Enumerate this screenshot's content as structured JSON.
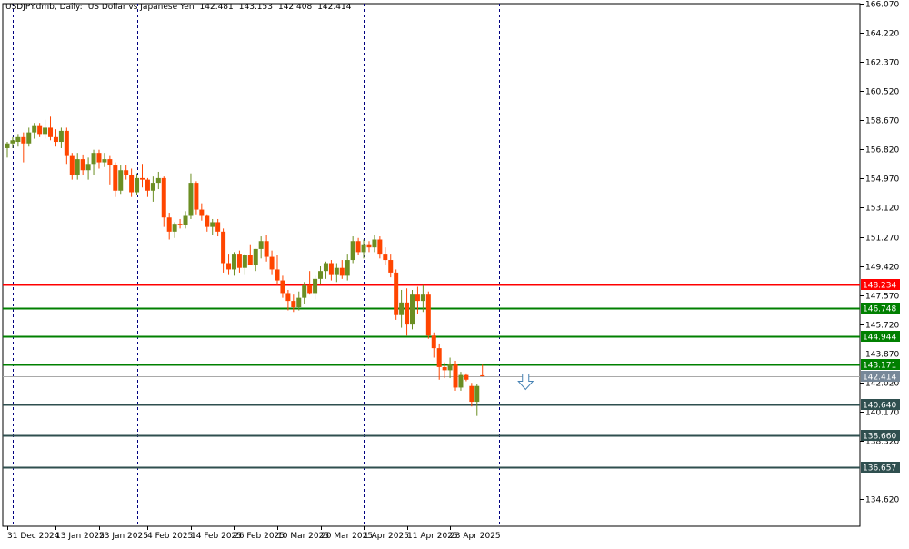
{
  "header": {
    "symbol": "USDJPY.dmb, Daily:",
    "description": "US Dollar vs Japanese Yen",
    "open": "142.481",
    "high": "143.153",
    "low": "142.408",
    "close": "142.414"
  },
  "chart_data": {
    "type": "candlestick",
    "ylim": [
      132.9,
      166.07
    ],
    "y_ticks": [
      "166.070",
      "164.220",
      "162.370",
      "160.520",
      "158.670",
      "156.820",
      "154.970",
      "153.120",
      "151.270",
      "149.420",
      "147.570",
      "145.720",
      "143.870",
      "142.020",
      "140.170",
      "138.320",
      "134.620"
    ],
    "x_labels": [
      {
        "label": "31 Dec 2024",
        "index": 0
      },
      {
        "label": "13 Jan 2025",
        "index": 9
      },
      {
        "label": "23 Jan 2025",
        "index": 17
      },
      {
        "label": "4 Feb 2025",
        "index": 26
      },
      {
        "label": "14 Feb 2025",
        "index": 34
      },
      {
        "label": "26 Feb 2025",
        "index": 42
      },
      {
        "label": "10 Mar 2025",
        "index": 50
      },
      {
        "label": "20 Mar 2025",
        "index": 58
      },
      {
        "label": "1 Apr 2025",
        "index": 66
      },
      {
        "label": "11 Apr 2025",
        "index": 74
      },
      {
        "label": "23 Apr 2025",
        "index": 82
      }
    ],
    "period_separators": [
      1,
      24,
      44,
      66,
      91
    ],
    "candles": [
      {
        "o": 156.9,
        "h": 157.3,
        "l": 156.3,
        "c": 157.2
      },
      {
        "o": 157.2,
        "h": 157.6,
        "l": 156.9,
        "c": 157.4
      },
      {
        "o": 157.3,
        "h": 157.8,
        "l": 157.0,
        "c": 157.6
      },
      {
        "o": 157.6,
        "h": 157.9,
        "l": 156.0,
        "c": 157.2
      },
      {
        "o": 157.2,
        "h": 158.2,
        "l": 157.0,
        "c": 157.9
      },
      {
        "o": 157.9,
        "h": 158.5,
        "l": 157.5,
        "c": 158.3
      },
      {
        "o": 158.3,
        "h": 158.5,
        "l": 157.6,
        "c": 157.8
      },
      {
        "o": 157.8,
        "h": 158.7,
        "l": 157.5,
        "c": 158.2
      },
      {
        "o": 158.2,
        "h": 158.9,
        "l": 157.4,
        "c": 157.6
      },
      {
        "o": 157.6,
        "h": 158.1,
        "l": 157.0,
        "c": 157.3
      },
      {
        "o": 157.3,
        "h": 158.2,
        "l": 156.9,
        "c": 158.0
      },
      {
        "o": 158.0,
        "h": 158.2,
        "l": 155.9,
        "c": 156.4
      },
      {
        "o": 156.4,
        "h": 156.6,
        "l": 154.9,
        "c": 155.2
      },
      {
        "o": 155.2,
        "h": 156.6,
        "l": 154.9,
        "c": 156.2
      },
      {
        "o": 156.2,
        "h": 156.5,
        "l": 155.2,
        "c": 155.5
      },
      {
        "o": 155.5,
        "h": 156.3,
        "l": 154.9,
        "c": 155.9
      },
      {
        "o": 155.9,
        "h": 156.8,
        "l": 155.2,
        "c": 156.6
      },
      {
        "o": 156.6,
        "h": 156.8,
        "l": 155.6,
        "c": 156.0
      },
      {
        "o": 156.0,
        "h": 156.6,
        "l": 155.7,
        "c": 156.2
      },
      {
        "o": 156.2,
        "h": 156.4,
        "l": 154.6,
        "c": 155.8
      },
      {
        "o": 155.8,
        "h": 156.0,
        "l": 153.8,
        "c": 154.2
      },
      {
        "o": 154.2,
        "h": 155.8,
        "l": 154.0,
        "c": 155.5
      },
      {
        "o": 155.5,
        "h": 155.8,
        "l": 154.9,
        "c": 155.2
      },
      {
        "o": 155.2,
        "h": 155.6,
        "l": 153.8,
        "c": 154.1
      },
      {
        "o": 154.1,
        "h": 155.3,
        "l": 153.9,
        "c": 155.0
      },
      {
        "o": 155.0,
        "h": 155.9,
        "l": 154.4,
        "c": 154.9
      },
      {
        "o": 154.9,
        "h": 155.0,
        "l": 153.8,
        "c": 154.2
      },
      {
        "o": 154.2,
        "h": 155.1,
        "l": 153.5,
        "c": 154.7
      },
      {
        "o": 154.7,
        "h": 155.4,
        "l": 154.3,
        "c": 155.0
      },
      {
        "o": 155.0,
        "h": 155.1,
        "l": 151.9,
        "c": 152.5
      },
      {
        "o": 152.5,
        "h": 152.8,
        "l": 151.1,
        "c": 151.6
      },
      {
        "o": 151.6,
        "h": 152.2,
        "l": 151.2,
        "c": 152.1
      },
      {
        "o": 152.1,
        "h": 152.4,
        "l": 151.8,
        "c": 152.0
      },
      {
        "o": 152.0,
        "h": 152.9,
        "l": 151.8,
        "c": 152.6
      },
      {
        "o": 152.6,
        "h": 155.3,
        "l": 152.4,
        "c": 154.7
      },
      {
        "o": 154.7,
        "h": 154.8,
        "l": 152.7,
        "c": 153.0
      },
      {
        "o": 153.0,
        "h": 153.4,
        "l": 152.3,
        "c": 152.6
      },
      {
        "o": 152.6,
        "h": 152.7,
        "l": 151.6,
        "c": 151.9
      },
      {
        "o": 151.9,
        "h": 152.4,
        "l": 151.4,
        "c": 152.2
      },
      {
        "o": 152.2,
        "h": 152.4,
        "l": 151.3,
        "c": 151.6
      },
      {
        "o": 151.6,
        "h": 151.8,
        "l": 149.0,
        "c": 149.6
      },
      {
        "o": 149.6,
        "h": 150.2,
        "l": 148.9,
        "c": 149.2
      },
      {
        "o": 149.2,
        "h": 150.3,
        "l": 148.8,
        "c": 150.2
      },
      {
        "o": 150.2,
        "h": 150.4,
        "l": 149.0,
        "c": 149.3
      },
      {
        "o": 149.3,
        "h": 150.2,
        "l": 148.9,
        "c": 150.1
      },
      {
        "o": 150.1,
        "h": 150.8,
        "l": 149.8,
        "c": 149.5
      },
      {
        "o": 149.5,
        "h": 150.5,
        "l": 149.1,
        "c": 150.5
      },
      {
        "o": 150.5,
        "h": 151.3,
        "l": 149.9,
        "c": 151.0
      },
      {
        "o": 151.0,
        "h": 151.4,
        "l": 149.7,
        "c": 150.0
      },
      {
        "o": 150.0,
        "h": 150.4,
        "l": 148.9,
        "c": 149.2
      },
      {
        "o": 149.2,
        "h": 150.1,
        "l": 148.2,
        "c": 148.5
      },
      {
        "o": 148.5,
        "h": 148.8,
        "l": 147.4,
        "c": 147.7
      },
      {
        "o": 147.7,
        "h": 147.9,
        "l": 146.6,
        "c": 147.2
      },
      {
        "o": 147.2,
        "h": 147.6,
        "l": 146.5,
        "c": 146.8
      },
      {
        "o": 146.8,
        "h": 147.8,
        "l": 146.6,
        "c": 147.4
      },
      {
        "o": 147.4,
        "h": 148.4,
        "l": 147.0,
        "c": 148.2
      },
      {
        "o": 148.2,
        "h": 149.1,
        "l": 147.6,
        "c": 147.7
      },
      {
        "o": 147.7,
        "h": 148.8,
        "l": 147.3,
        "c": 148.6
      },
      {
        "o": 148.6,
        "h": 149.4,
        "l": 148.3,
        "c": 149.1
      },
      {
        "o": 149.1,
        "h": 149.7,
        "l": 148.6,
        "c": 149.6
      },
      {
        "o": 149.6,
        "h": 149.8,
        "l": 148.5,
        "c": 148.9
      },
      {
        "o": 148.9,
        "h": 149.6,
        "l": 148.4,
        "c": 149.3
      },
      {
        "o": 149.3,
        "h": 149.8,
        "l": 148.6,
        "c": 148.8
      },
      {
        "o": 148.8,
        "h": 150.2,
        "l": 148.5,
        "c": 149.8
      },
      {
        "o": 149.8,
        "h": 151.3,
        "l": 149.6,
        "c": 151.0
      },
      {
        "o": 151.0,
        "h": 151.2,
        "l": 150.1,
        "c": 150.3
      },
      {
        "o": 150.3,
        "h": 151.1,
        "l": 149.9,
        "c": 150.8
      },
      {
        "o": 150.8,
        "h": 151.0,
        "l": 150.3,
        "c": 150.6
      },
      {
        "o": 150.6,
        "h": 151.4,
        "l": 150.3,
        "c": 151.1
      },
      {
        "o": 151.1,
        "h": 151.3,
        "l": 149.9,
        "c": 150.2
      },
      {
        "o": 150.2,
        "h": 150.6,
        "l": 149.5,
        "c": 149.8
      },
      {
        "o": 149.8,
        "h": 150.2,
        "l": 148.7,
        "c": 149.0
      },
      {
        "o": 149.0,
        "h": 149.2,
        "l": 146.0,
        "c": 146.3
      },
      {
        "o": 146.3,
        "h": 147.9,
        "l": 145.5,
        "c": 147.1
      },
      {
        "o": 147.1,
        "h": 148.0,
        "l": 145.0,
        "c": 145.7
      },
      {
        "o": 145.7,
        "h": 147.9,
        "l": 145.4,
        "c": 147.6
      },
      {
        "o": 147.6,
        "h": 148.1,
        "l": 146.4,
        "c": 147.2
      },
      {
        "o": 147.2,
        "h": 148.2,
        "l": 146.5,
        "c": 147.6
      },
      {
        "o": 147.6,
        "h": 147.8,
        "l": 144.8,
        "c": 145.0
      },
      {
        "o": 145.0,
        "h": 145.2,
        "l": 143.6,
        "c": 144.2
      },
      {
        "o": 144.2,
        "h": 144.5,
        "l": 142.2,
        "c": 143.0
      },
      {
        "o": 143.0,
        "h": 143.3,
        "l": 142.3,
        "c": 142.8
      },
      {
        "o": 142.8,
        "h": 143.6,
        "l": 142.3,
        "c": 143.2
      },
      {
        "o": 143.2,
        "h": 143.4,
        "l": 141.5,
        "c": 141.7
      },
      {
        "o": 141.7,
        "h": 142.7,
        "l": 141.5,
        "c": 142.5
      },
      {
        "o": 142.5,
        "h": 142.6,
        "l": 142.1,
        "c": 142.2
      },
      {
        "o": 141.8,
        "h": 142.0,
        "l": 140.5,
        "c": 140.8
      },
      {
        "o": 140.8,
        "h": 141.9,
        "l": 139.9,
        "c": 141.8
      },
      {
        "o": 142.481,
        "h": 143.153,
        "l": 142.408,
        "c": 142.414
      }
    ],
    "horizontal_levels": [
      {
        "price": 148.234,
        "label": "148.234",
        "color": "#ff0000"
      },
      {
        "price": 146.748,
        "label": "146.748",
        "color": "#008000"
      },
      {
        "price": 144.944,
        "label": "144.944",
        "color": "#008000"
      },
      {
        "price": 143.171,
        "label": "143.171",
        "color": "#008000"
      },
      {
        "price": 140.64,
        "label": "140.640",
        "color": "#2f4f4f"
      },
      {
        "price": 138.66,
        "label": "138.660",
        "color": "#2f4f4f"
      },
      {
        "price": 136.657,
        "label": "136.657",
        "color": "#2f4f4f"
      }
    ],
    "current_price": {
      "price": 142.414,
      "label": "142.414",
      "color": "#778899"
    },
    "arrow": {
      "type": "down",
      "index": 96,
      "price": 142.1
    },
    "colors": {
      "bull": "#6b8e23",
      "bear": "#ff4500",
      "grid": "#000080",
      "axis": "#000000"
    }
  }
}
